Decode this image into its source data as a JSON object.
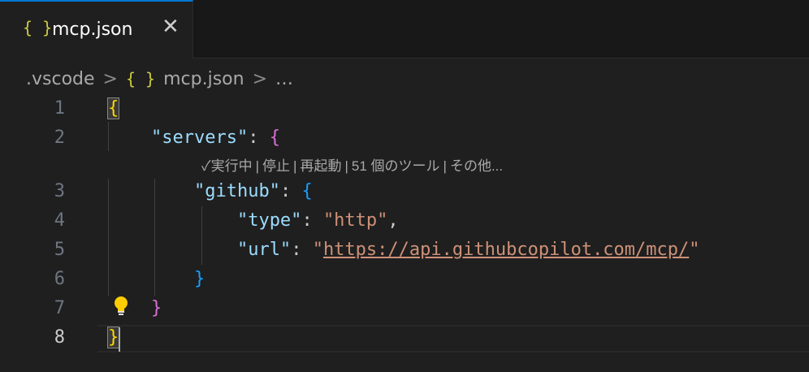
{
  "tab": {
    "icon": "{ }",
    "label": "mcp.json",
    "close": "✕"
  },
  "breadcrumb": {
    "folder": ".vscode",
    "file_icon": "{ }",
    "file": "mcp.json",
    "more": "…",
    "separator": ">"
  },
  "codelens": {
    "items": [
      "✓実行中",
      "停止",
      "再起動",
      "51 個のツール",
      "その他..."
    ]
  },
  "lines": [
    {
      "n": "1",
      "indent": "",
      "tokens": [
        [
          "br1",
          "{"
        ]
      ]
    },
    {
      "n": "2",
      "indent": "    ",
      "tokens": [
        [
          "key",
          "\"servers\""
        ],
        [
          "plain",
          ": "
        ],
        [
          "br2",
          "{"
        ]
      ]
    },
    {
      "n": "3",
      "indent": "        ",
      "tokens": [
        [
          "key",
          "\"github\""
        ],
        [
          "plain",
          ": "
        ],
        [
          "br3",
          "{"
        ]
      ]
    },
    {
      "n": "4",
      "indent": "            ",
      "tokens": [
        [
          "key",
          "\"type\""
        ],
        [
          "plain",
          ": "
        ],
        [
          "str",
          "\"http\""
        ],
        [
          "plain",
          ","
        ]
      ]
    },
    {
      "n": "5",
      "indent": "            ",
      "tokens": [
        [
          "key",
          "\"url\""
        ],
        [
          "plain",
          ": "
        ],
        [
          "str",
          "\""
        ],
        [
          "url",
          "https://api.githubcopilot.com/mcp/"
        ],
        [
          "str",
          "\""
        ]
      ]
    },
    {
      "n": "6",
      "indent": "        ",
      "tokens": [
        [
          "br3",
          "}"
        ]
      ]
    },
    {
      "n": "7",
      "indent": "    ",
      "tokens": [
        [
          "br2",
          "}"
        ]
      ]
    },
    {
      "n": "8",
      "indent": "",
      "tokens": [
        [
          "br1",
          "}"
        ]
      ]
    }
  ],
  "colors": {
    "accent": "#0078d4",
    "background": "#1f1f1f",
    "json_icon": "#cbcb41"
  }
}
